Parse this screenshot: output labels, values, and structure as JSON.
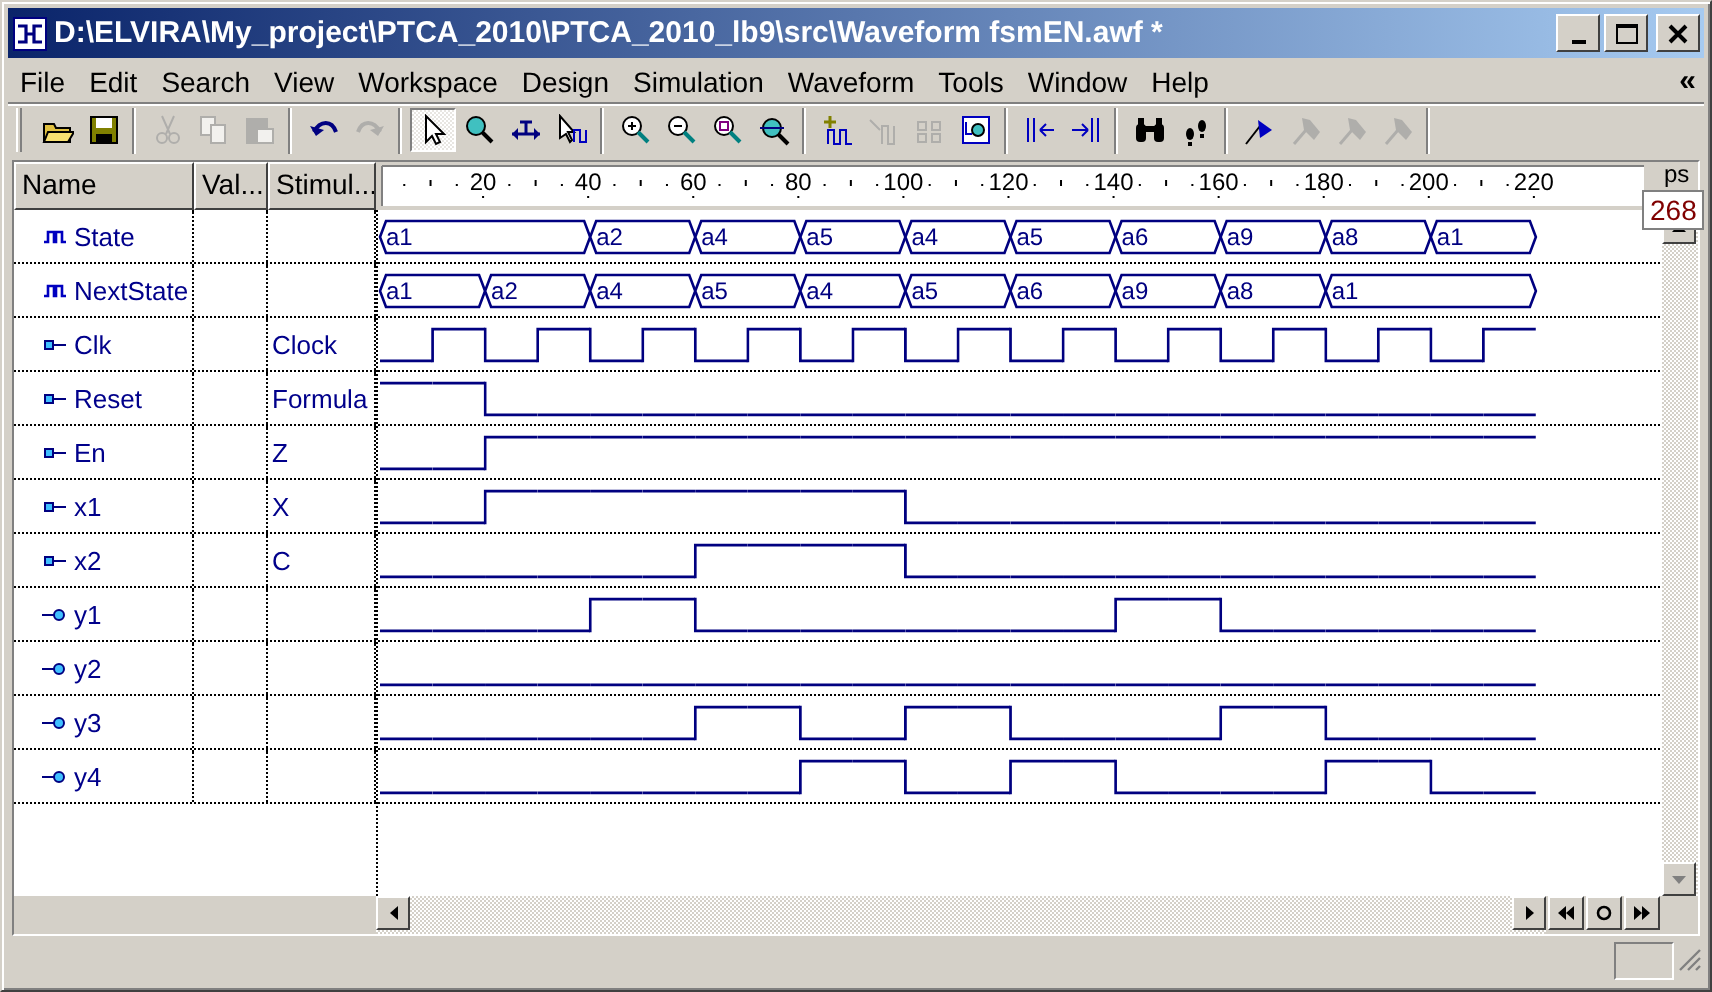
{
  "window": {
    "title": "D:\\ELVIRA\\My_project\\PTCA_2010\\PTCA_2010_lb9\\src\\Waveform fsmEN.awf *"
  },
  "menu": [
    {
      "label": "File"
    },
    {
      "label": "Edit"
    },
    {
      "label": "Search"
    },
    {
      "label": "View"
    },
    {
      "label": "Workspace"
    },
    {
      "label": "Design"
    },
    {
      "label": "Simulation"
    },
    {
      "label": "Waveform"
    },
    {
      "label": "Tools"
    },
    {
      "label": "Window"
    },
    {
      "label": "Help"
    }
  ],
  "menu_chevron": "«",
  "toolbar": [
    [
      {
        "kind": "open",
        "disabled": false,
        "selected": false
      },
      {
        "kind": "save",
        "disabled": false,
        "selected": false
      }
    ],
    [
      {
        "kind": "cut",
        "disabled": true,
        "selected": false
      },
      {
        "kind": "copy",
        "disabled": true,
        "selected": false
      },
      {
        "kind": "paste",
        "disabled": true,
        "selected": false
      }
    ],
    [
      {
        "kind": "undo",
        "disabled": false,
        "selected": false
      },
      {
        "kind": "redo",
        "disabled": true,
        "selected": false
      }
    ],
    [
      {
        "kind": "pointer",
        "disabled": false,
        "selected": true
      },
      {
        "kind": "zoom",
        "disabled": false,
        "selected": false
      },
      {
        "kind": "measure",
        "disabled": false,
        "selected": false
      },
      {
        "kind": "pick",
        "disabled": false,
        "selected": false
      }
    ],
    [
      {
        "kind": "zoomin",
        "disabled": false,
        "selected": false
      },
      {
        "kind": "zoomout",
        "disabled": false,
        "selected": false
      },
      {
        "kind": "zoomfit",
        "disabled": false,
        "selected": false
      },
      {
        "kind": "zoomfull",
        "disabled": false,
        "selected": false
      }
    ],
    [
      {
        "kind": "addwave",
        "disabled": false,
        "selected": false
      },
      {
        "kind": "delwave",
        "disabled": true,
        "selected": false
      },
      {
        "kind": "group",
        "disabled": true,
        "selected": false
      },
      {
        "kind": "inspect",
        "disabled": false,
        "selected": false
      }
    ],
    [
      {
        "kind": "prevedge",
        "disabled": false,
        "selected": false
      },
      {
        "kind": "nextedge",
        "disabled": false,
        "selected": false
      }
    ],
    [
      {
        "kind": "find",
        "disabled": false,
        "selected": false
      },
      {
        "kind": "steps",
        "disabled": false,
        "selected": false
      }
    ],
    [
      {
        "kind": "flag",
        "disabled": false,
        "selected": false
      },
      {
        "kind": "tool",
        "disabled": true,
        "selected": false
      },
      {
        "kind": "tool",
        "disabled": true,
        "selected": false
      },
      {
        "kind": "tool",
        "disabled": true,
        "selected": false
      }
    ]
  ],
  "columns": [
    "Name",
    "Val...",
    "Stimul..."
  ],
  "ruler": {
    "ticks": [
      "20",
      "40",
      "60",
      "80",
      "100",
      "120",
      "140",
      "160",
      "180",
      "200",
      "220"
    ],
    "unit": "ps"
  },
  "cursor_time": "268",
  "signals": [
    {
      "name": "State",
      "kind": "bus",
      "segments": [
        {
          "label": "a1",
          "long": true
        },
        {
          "label": "a2",
          "long": false
        },
        {
          "label": "a4",
          "long": false
        },
        {
          "label": "a5",
          "long": false
        },
        {
          "label": "a4",
          "long": false
        },
        {
          "label": "a5",
          "long": false
        },
        {
          "label": "a6",
          "long": false
        },
        {
          "label": "a9",
          "long": false
        },
        {
          "label": "a8",
          "long": false
        },
        {
          "label": "a1",
          "long": false
        }
      ]
    },
    {
      "name": "NextState",
      "kind": "bus",
      "segments": [
        {
          "label": "a1",
          "long": false
        },
        {
          "label": "a2",
          "long": false
        },
        {
          "label": "a4",
          "long": false
        },
        {
          "label": "a5",
          "long": false
        },
        {
          "label": "a4",
          "long": false
        },
        {
          "label": "a5",
          "long": false
        },
        {
          "label": "a6",
          "long": false
        },
        {
          "label": "a9",
          "long": false
        },
        {
          "label": "a8",
          "long": false
        },
        {
          "label": "a1",
          "long": true
        }
      ]
    },
    {
      "name": "Clk",
      "kind": "input",
      "stimulus": "Clock",
      "wave": [
        {
          "high": false
        },
        {
          "high": true
        },
        {
          "high": false
        },
        {
          "high": true
        },
        {
          "high": false
        },
        {
          "high": true
        },
        {
          "high": false
        },
        {
          "high": true
        },
        {
          "high": false
        },
        {
          "high": true
        },
        {
          "high": false
        },
        {
          "high": true
        },
        {
          "high": false
        },
        {
          "high": true
        },
        {
          "high": false
        },
        {
          "high": true
        },
        {
          "high": false
        },
        {
          "high": true
        },
        {
          "high": false
        },
        {
          "high": true
        },
        {
          "high": false
        },
        {
          "high": true
        }
      ]
    },
    {
      "name": "Reset",
      "kind": "input",
      "stimulus": "Formula",
      "wave": [
        {
          "high": true
        },
        {
          "high": true
        },
        {
          "high": false
        },
        {
          "high": false
        },
        {
          "high": false
        },
        {
          "high": false
        },
        {
          "high": false
        },
        {
          "high": false
        },
        {
          "high": false
        },
        {
          "high": false
        },
        {
          "high": false
        },
        {
          "high": false
        },
        {
          "high": false
        },
        {
          "high": false
        },
        {
          "high": false
        },
        {
          "high": false
        },
        {
          "high": false
        },
        {
          "high": false
        },
        {
          "high": false
        },
        {
          "high": false
        },
        {
          "high": false
        },
        {
          "high": false
        }
      ]
    },
    {
      "name": "En",
      "kind": "input",
      "stimulus": "Z",
      "wave": [
        {
          "high": false
        },
        {
          "high": false
        },
        {
          "high": true
        },
        {
          "high": true
        },
        {
          "high": true
        },
        {
          "high": true
        },
        {
          "high": true
        },
        {
          "high": true
        },
        {
          "high": true
        },
        {
          "high": true
        },
        {
          "high": true
        },
        {
          "high": true
        },
        {
          "high": true
        },
        {
          "high": true
        },
        {
          "high": true
        },
        {
          "high": true
        },
        {
          "high": true
        },
        {
          "high": true
        },
        {
          "high": true
        },
        {
          "high": true
        },
        {
          "high": true
        },
        {
          "high": true
        }
      ]
    },
    {
      "name": "x1",
      "kind": "input",
      "stimulus": "X",
      "wave": [
        {
          "high": false
        },
        {
          "high": false
        },
        {
          "high": true
        },
        {
          "high": true
        },
        {
          "high": true
        },
        {
          "high": true
        },
        {
          "high": true
        },
        {
          "high": true
        },
        {
          "high": true
        },
        {
          "high": true
        },
        {
          "high": false
        },
        {
          "high": false
        },
        {
          "high": false
        },
        {
          "high": false
        },
        {
          "high": false
        },
        {
          "high": false
        },
        {
          "high": false
        },
        {
          "high": false
        },
        {
          "high": false
        },
        {
          "high": false
        },
        {
          "high": false
        },
        {
          "high": false
        }
      ]
    },
    {
      "name": "x2",
      "kind": "input",
      "stimulus": "C",
      "wave": [
        {
          "high": false
        },
        {
          "high": false
        },
        {
          "high": false
        },
        {
          "high": false
        },
        {
          "high": false
        },
        {
          "high": false
        },
        {
          "high": true
        },
        {
          "high": true
        },
        {
          "high": true
        },
        {
          "high": true
        },
        {
          "high": false
        },
        {
          "high": false
        },
        {
          "high": false
        },
        {
          "high": false
        },
        {
          "high": false
        },
        {
          "high": false
        },
        {
          "high": false
        },
        {
          "high": false
        },
        {
          "high": false
        },
        {
          "high": false
        },
        {
          "high": false
        },
        {
          "high": false
        }
      ]
    },
    {
      "name": "y1",
      "kind": "output",
      "wave": [
        {
          "high": false
        },
        {
          "high": false
        },
        {
          "high": false
        },
        {
          "high": false
        },
        {
          "high": true
        },
        {
          "high": true
        },
        {
          "high": false
        },
        {
          "high": false
        },
        {
          "high": false
        },
        {
          "high": false
        },
        {
          "high": false
        },
        {
          "high": false
        },
        {
          "high": false
        },
        {
          "high": false
        },
        {
          "high": true
        },
        {
          "high": true
        },
        {
          "high": false
        },
        {
          "high": false
        },
        {
          "high": false
        },
        {
          "high": false
        },
        {
          "high": false
        },
        {
          "high": false
        }
      ]
    },
    {
      "name": "y2",
      "kind": "output",
      "wave": [
        {
          "high": false
        },
        {
          "high": false
        },
        {
          "high": false
        },
        {
          "high": false
        },
        {
          "high": false
        },
        {
          "high": false
        },
        {
          "high": false
        },
        {
          "high": false
        },
        {
          "high": false
        },
        {
          "high": false
        },
        {
          "high": false
        },
        {
          "high": false
        },
        {
          "high": false
        },
        {
          "high": false
        },
        {
          "high": false
        },
        {
          "high": false
        },
        {
          "high": false
        },
        {
          "high": false
        },
        {
          "high": false
        },
        {
          "high": false
        },
        {
          "high": false
        },
        {
          "high": false
        }
      ]
    },
    {
      "name": "y3",
      "kind": "output",
      "wave": [
        {
          "high": false
        },
        {
          "high": false
        },
        {
          "high": false
        },
        {
          "high": false
        },
        {
          "high": false
        },
        {
          "high": false
        },
        {
          "high": true
        },
        {
          "high": true
        },
        {
          "high": false
        },
        {
          "high": false
        },
        {
          "high": true
        },
        {
          "high": true
        },
        {
          "high": false
        },
        {
          "high": false
        },
        {
          "high": false
        },
        {
          "high": false
        },
        {
          "high": true
        },
        {
          "high": true
        },
        {
          "high": false
        },
        {
          "high": false
        },
        {
          "high": false
        },
        {
          "high": false
        }
      ]
    },
    {
      "name": "y4",
      "kind": "output",
      "wave": [
        {
          "high": false
        },
        {
          "high": false
        },
        {
          "high": false
        },
        {
          "high": false
        },
        {
          "high": false
        },
        {
          "high": false
        },
        {
          "high": false
        },
        {
          "high": false
        },
        {
          "high": true
        },
        {
          "high": true
        },
        {
          "high": false
        },
        {
          "high": false
        },
        {
          "high": true
        },
        {
          "high": true
        },
        {
          "high": false
        },
        {
          "high": false
        },
        {
          "high": false
        },
        {
          "high": false
        },
        {
          "high": true
        },
        {
          "high": true
        },
        {
          "high": false
        },
        {
          "high": false
        }
      ]
    }
  ]
}
